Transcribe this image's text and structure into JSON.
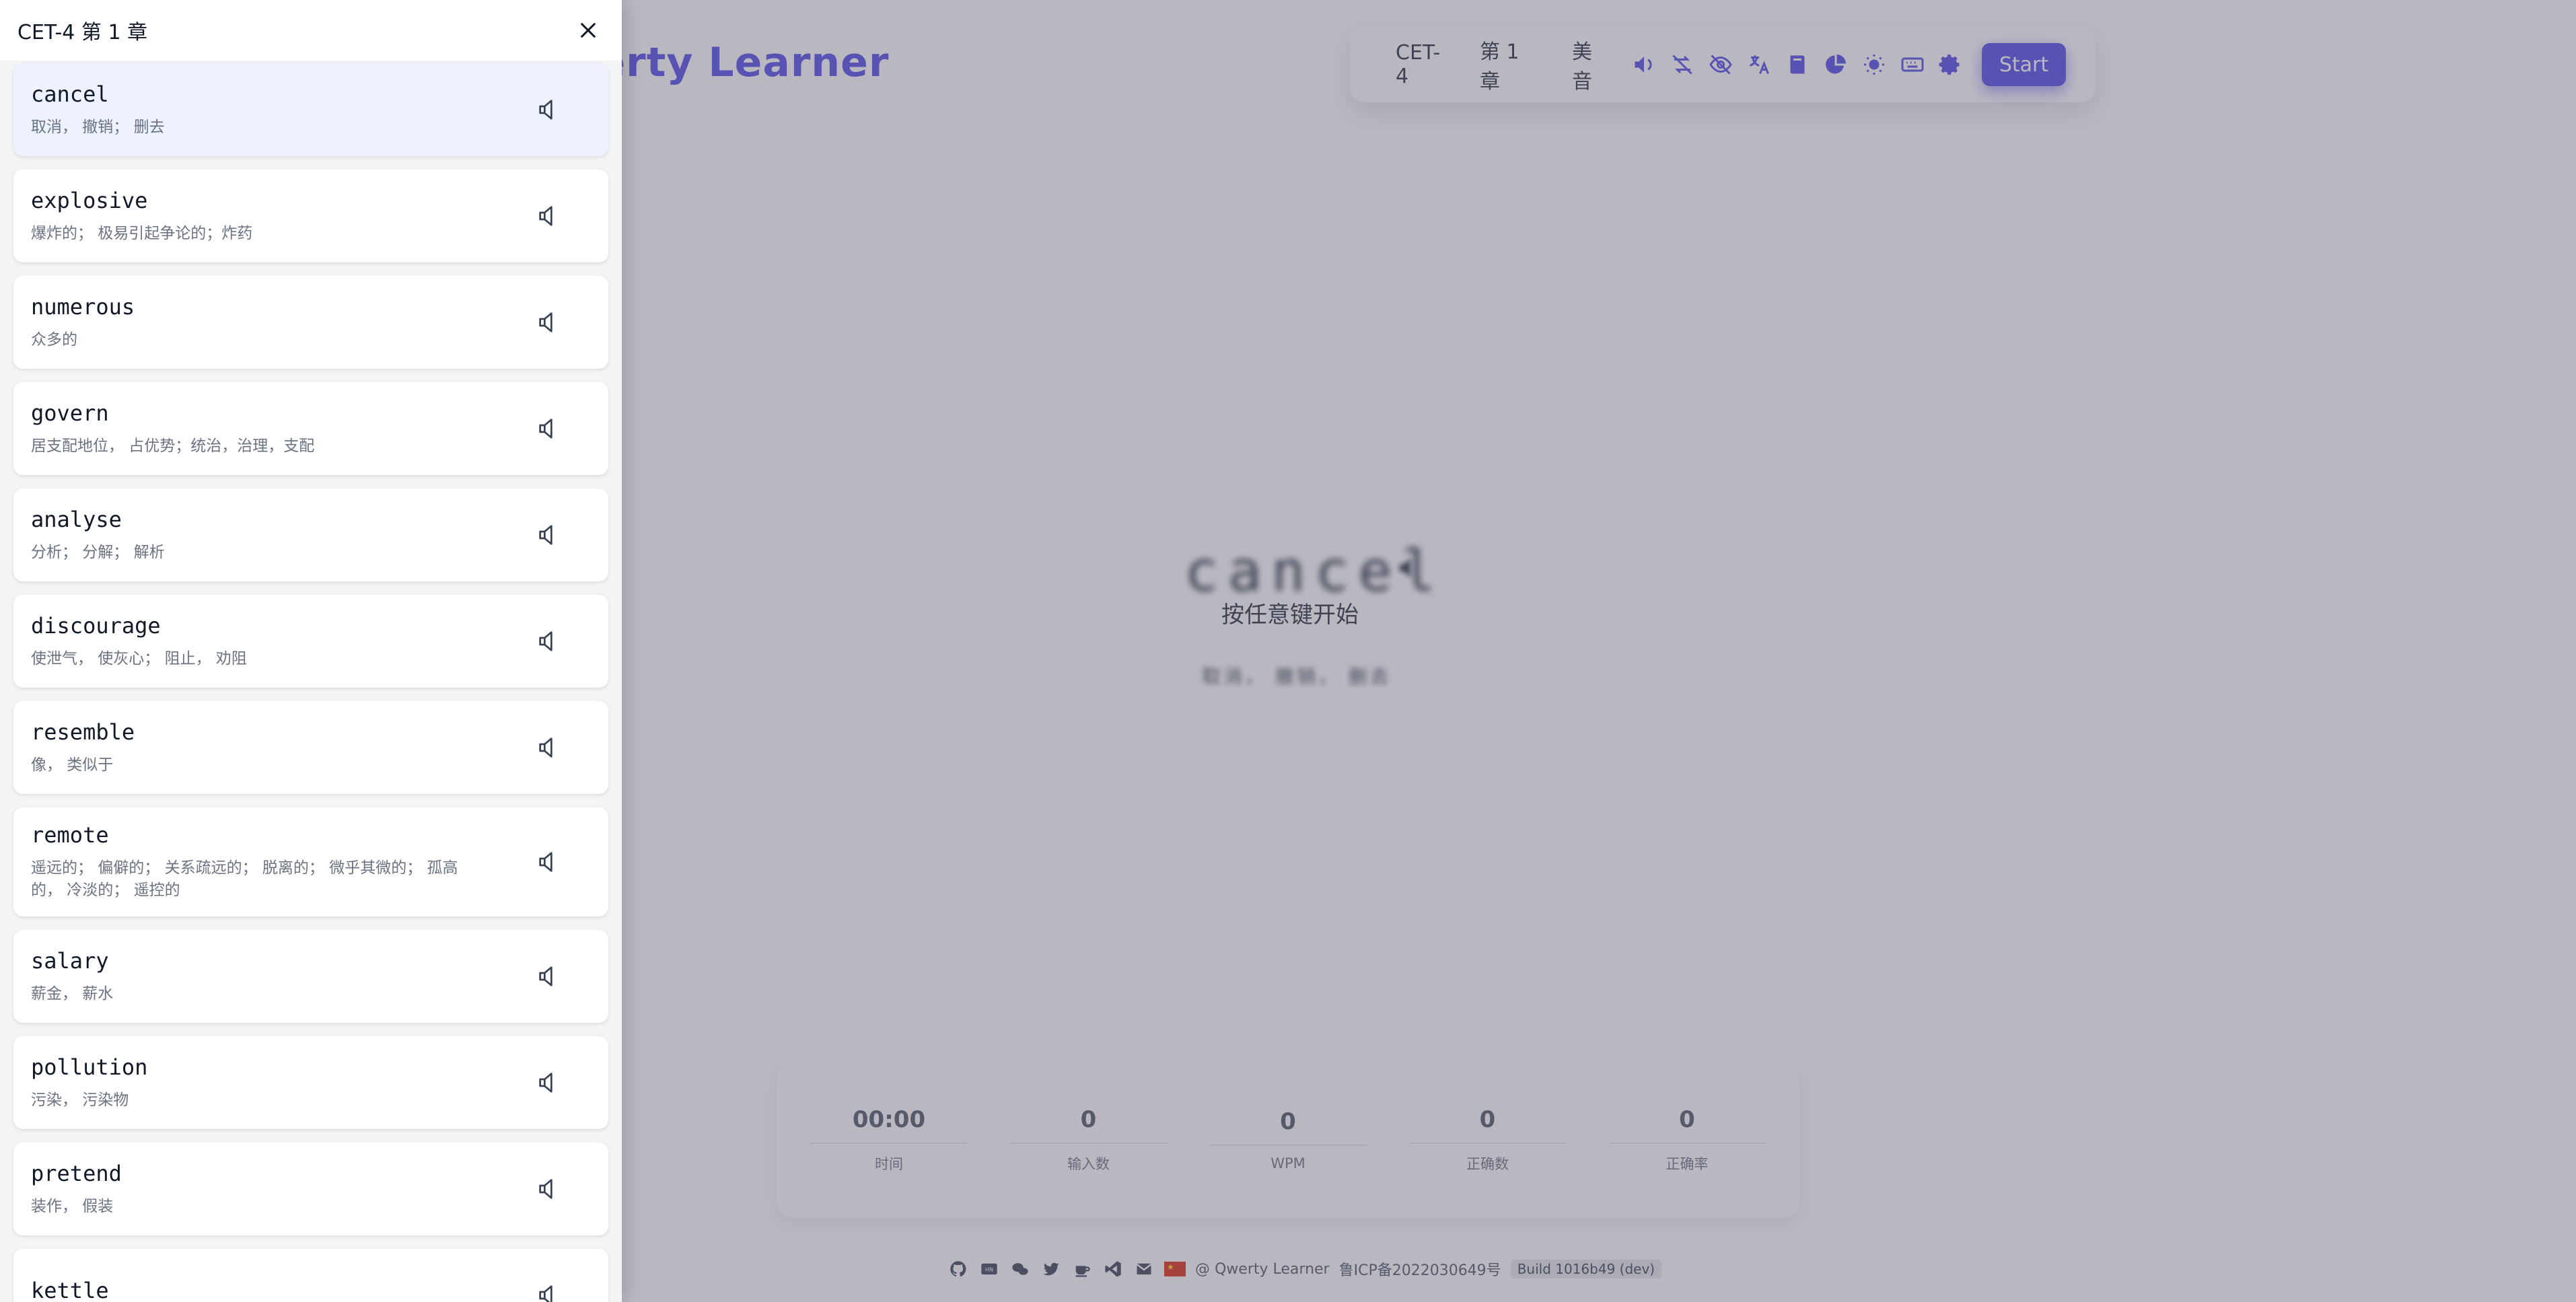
{
  "app": {
    "logo_text": "Qwerty Learner"
  },
  "toolbar": {
    "dictionary": "CET-4",
    "chapter": "第 1 章",
    "pronunciation": "美音",
    "start_label": "Start",
    "icons": [
      "sound-icon",
      "loop-off-icon",
      "hide-word-icon",
      "translate-icon",
      "book-icon",
      "pie-chart-icon",
      "sun-icon",
      "keyboard-icon",
      "gear-icon"
    ],
    "accent_color": "#4f46e5"
  },
  "main": {
    "current_word": "cancel",
    "press_hint": "按任意键开始",
    "current_translation": "取消， 撤销， 删去"
  },
  "stats": [
    {
      "value": "00:00",
      "label": "时间"
    },
    {
      "value": "0",
      "label": "输入数"
    },
    {
      "value": "0",
      "label": "WPM"
    },
    {
      "value": "0",
      "label": "正确数"
    },
    {
      "value": "0",
      "label": "正确率"
    }
  ],
  "footer": {
    "copyright": "@ Qwerty Learner",
    "icp": "鲁ICP备2022030649号",
    "build": "Build 1016b49 (dev)"
  },
  "sidebar": {
    "title": "CET-4 第 1 章",
    "words": [
      {
        "word": "cancel",
        "trans": "取消， 撤销； 删去",
        "active": true
      },
      {
        "word": "explosive",
        "trans": "爆炸的； 极易引起争论的；炸药"
      },
      {
        "word": "numerous",
        "trans": "众多的"
      },
      {
        "word": "govern",
        "trans": "居支配地位， 占优势；统治，治理，支配"
      },
      {
        "word": "analyse",
        "trans": "分析； 分解； 解析"
      },
      {
        "word": "discourage",
        "trans": "使泄气， 使灰心； 阻止， 劝阻"
      },
      {
        "word": "resemble",
        "trans": "像， 类似于"
      },
      {
        "word": "remote",
        "trans": "遥远的； 偏僻的； 关系疏远的； 脱离的； 微乎其微的； 孤高的， 冷淡的； 遥控的"
      },
      {
        "word": "salary",
        "trans": "薪金， 薪水"
      },
      {
        "word": "pollution",
        "trans": "污染， 污染物"
      },
      {
        "word": "pretend",
        "trans": "装作， 假装"
      },
      {
        "word": "kettle",
        "trans": ""
      }
    ]
  }
}
